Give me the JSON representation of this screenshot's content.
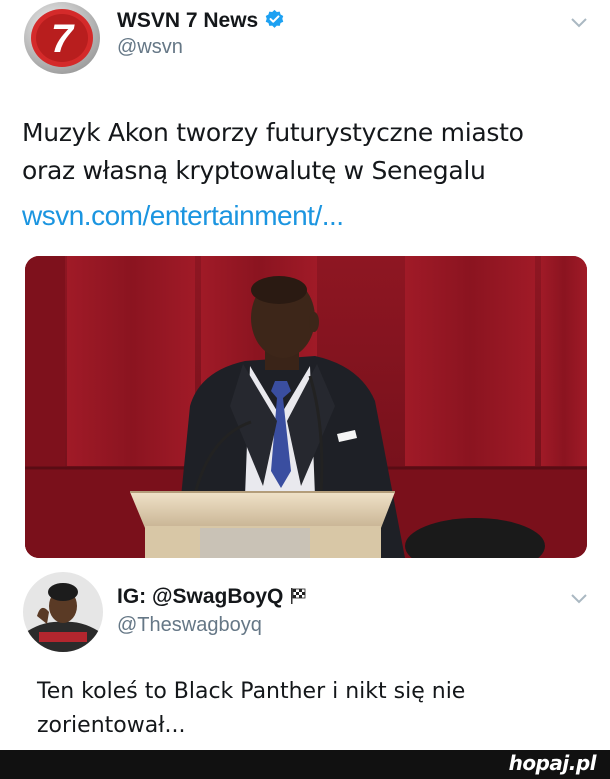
{
  "tweet": {
    "author_name": "WSVN 7 News",
    "author_handle": "@wsvn",
    "avatar_label": "7",
    "text_line1": "Muzyk Akon tworzy futurystyczne miasto",
    "text_line2": "oraz własną kryptowalutę w Senegalu",
    "link": "wsvn.com/entertainment/...",
    "verified": true,
    "media_icon": "photo-podium-speaker"
  },
  "reply": {
    "author_name": "IG: @SwagBoyQ",
    "author_handle": "@Theswagboyq",
    "text_line1": "Ten koleś to Black Panther i nikt się nie",
    "text_line2": "zorientował...",
    "flag_icon": "checkered-flag-icon"
  },
  "footer": {
    "logo": "hopaj.pl"
  },
  "colors": {
    "link": "#1b95e0",
    "handle": "#657786",
    "verified": "#1da1f2",
    "wsvn_red": "#d42a2a",
    "footer": "#111111"
  }
}
